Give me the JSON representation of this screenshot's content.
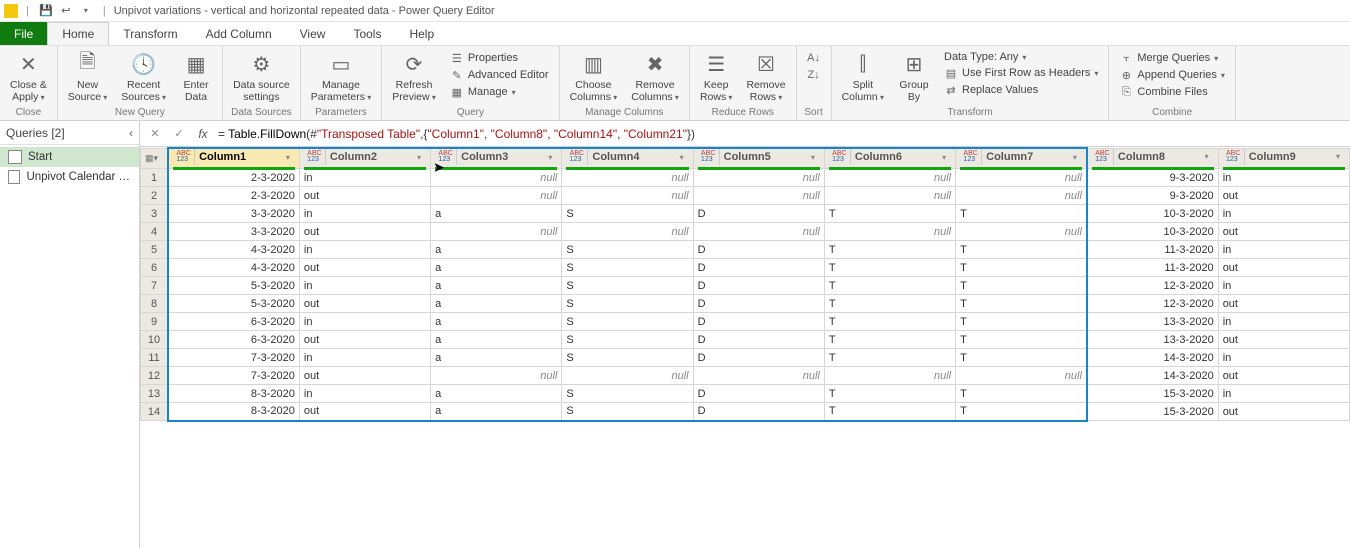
{
  "titlebar": {
    "app_title": "Unpivot variations - vertical and horizontal repeated data - Power Query Editor"
  },
  "tabs": {
    "file": "File",
    "home": "Home",
    "transform": "Transform",
    "add_column": "Add Column",
    "view": "View",
    "tools": "Tools",
    "help": "Help"
  },
  "ribbon": {
    "close_apply": "Close &\nApply",
    "close_group": "Close",
    "new_source": "New\nSource",
    "recent_sources": "Recent\nSources",
    "enter_data": "Enter\nData",
    "new_query_group": "New Query",
    "data_source_settings": "Data source\nsettings",
    "data_sources_group": "Data Sources",
    "manage_parameters": "Manage\nParameters",
    "parameters_group": "Parameters",
    "refresh_preview": "Refresh\nPreview",
    "properties": "Properties",
    "advanced_editor": "Advanced Editor",
    "manage": "Manage",
    "query_group": "Query",
    "choose_columns": "Choose\nColumns",
    "remove_columns": "Remove\nColumns",
    "manage_columns_group": "Manage Columns",
    "keep_rows": "Keep\nRows",
    "remove_rows": "Remove\nRows",
    "reduce_rows_group": "Reduce Rows",
    "sort_group": "Sort",
    "split_column": "Split\nColumn",
    "group_by": "Group\nBy",
    "data_type": "Data Type: Any",
    "first_row_headers": "Use First Row as Headers",
    "replace_values": "Replace Values",
    "transform_group": "Transform",
    "merge_queries": "Merge Queries",
    "append_queries": "Append Queries",
    "combine_files": "Combine Files",
    "combine_group": "Combine"
  },
  "queries": {
    "header": "Queries [2]",
    "items": [
      {
        "name": "Start"
      },
      {
        "name": "Unpivot Calendar to T..."
      }
    ]
  },
  "formula": {
    "prefix": "= ",
    "fn": "Table.FillDown",
    "args_open": "(#",
    "str1": "\"Transposed Table\"",
    "mid": ",{",
    "str2": "\"Column1\"",
    "c1": ", ",
    "str3": "\"Column8\"",
    "c2": ", ",
    "str4": "\"Column14\"",
    "c3": ", ",
    "str5": "\"Column21\"",
    "end": "})"
  },
  "grid": {
    "columns": [
      "Column1",
      "Column2",
      "Column3",
      "Column4",
      "Column5",
      "Column6",
      "Column7",
      "Column8",
      "Column9"
    ],
    "rows": [
      [
        "2-3-2020",
        "in",
        "null",
        "null",
        "null",
        "null",
        "null",
        "9-3-2020",
        "in"
      ],
      [
        "2-3-2020",
        "out",
        "null",
        "null",
        "null",
        "null",
        "null",
        "9-3-2020",
        "out"
      ],
      [
        "3-3-2020",
        "in",
        "a",
        "S",
        "D",
        "T",
        "T",
        "10-3-2020",
        "in"
      ],
      [
        "3-3-2020",
        "out",
        "null",
        "null",
        "null",
        "null",
        "null",
        "10-3-2020",
        "out"
      ],
      [
        "4-3-2020",
        "in",
        "a",
        "S",
        "D",
        "T",
        "T",
        "11-3-2020",
        "in"
      ],
      [
        "4-3-2020",
        "out",
        "a",
        "S",
        "D",
        "T",
        "T",
        "11-3-2020",
        "out"
      ],
      [
        "5-3-2020",
        "in",
        "a",
        "S",
        "D",
        "T",
        "T",
        "12-3-2020",
        "in"
      ],
      [
        "5-3-2020",
        "out",
        "a",
        "S",
        "D",
        "T",
        "T",
        "12-3-2020",
        "out"
      ],
      [
        "6-3-2020",
        "in",
        "a",
        "S",
        "D",
        "T",
        "T",
        "13-3-2020",
        "in"
      ],
      [
        "6-3-2020",
        "out",
        "a",
        "S",
        "D",
        "T",
        "T",
        "13-3-2020",
        "out"
      ],
      [
        "7-3-2020",
        "in",
        "a",
        "S",
        "D",
        "T",
        "T",
        "14-3-2020",
        "in"
      ],
      [
        "7-3-2020",
        "out",
        "null",
        "null",
        "null",
        "null",
        "null",
        "14-3-2020",
        "out"
      ],
      [
        "8-3-2020",
        "in",
        "a",
        "S",
        "D",
        "T",
        "T",
        "15-3-2020",
        "in"
      ],
      [
        "8-3-2020",
        "out",
        "a",
        "S",
        "D",
        "T",
        "T",
        "15-3-2020",
        "out"
      ]
    ]
  }
}
